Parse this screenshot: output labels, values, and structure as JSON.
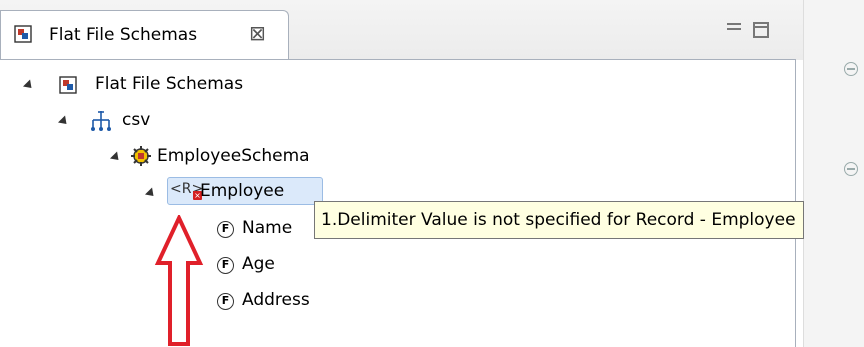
{
  "tab": {
    "title": "Flat File Schemas",
    "close_glyph": "⊠"
  },
  "tree": {
    "root": {
      "label": "Flat File Schemas",
      "icon": "schema-file-icon"
    },
    "csv": {
      "label": "csv",
      "icon": "hierarchy-icon"
    },
    "schema": {
      "label": "EmployeeSchema",
      "icon": "schema-gear-icon"
    },
    "record": {
      "label": "Employee",
      "icon_text": "<R>",
      "icon": "record-error-icon"
    },
    "fields": [
      {
        "label": "Name",
        "icon_text": "F",
        "icon": "field-icon"
      },
      {
        "label": "Age",
        "icon_text": "F",
        "icon": "field-icon"
      },
      {
        "label": "Address",
        "icon_text": "F",
        "icon": "field-icon"
      }
    ]
  },
  "tooltip": {
    "text": "1.Delimiter Value is not specified for Record - Employee"
  },
  "annotation": {
    "icon": "red-up-arrow-icon",
    "color": "#e0202a"
  },
  "colors": {
    "selection": "#dbe9fa",
    "tooltip_bg": "#ffffe1",
    "accent": "#1e5aa8"
  }
}
